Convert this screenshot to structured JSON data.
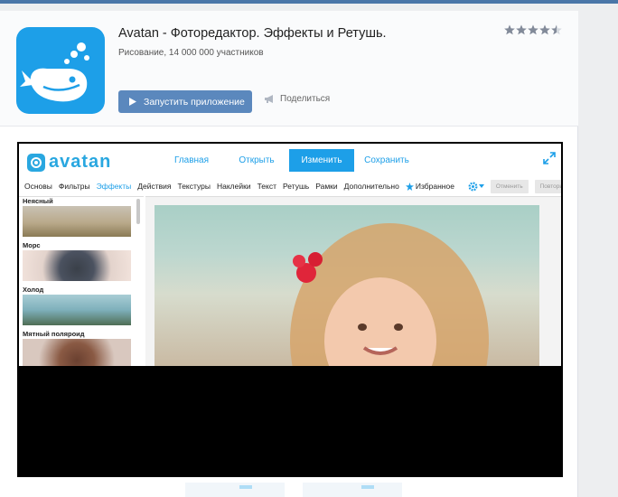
{
  "app": {
    "title": "Avatan - Фоторедактор. Эффекты и Ретушь.",
    "subtitle": "Рисование, 14 000 000 участников",
    "rating_stars": 4.5,
    "launch_label": "Запустить приложение",
    "share_label": "Поделиться"
  },
  "editor": {
    "logo_text": "avatan",
    "nav": [
      {
        "label": "Главная"
      },
      {
        "label": "Открыть"
      },
      {
        "label": "Изменить",
        "active": true
      },
      {
        "label": "Сохранить"
      }
    ],
    "tools": [
      "Основы",
      "Фильтры",
      "Эффекты",
      "Действия",
      "Текстуры",
      "Наклейки",
      "Текст",
      "Ретушь",
      "Рамки",
      "Дополнительно"
    ],
    "selected_tool": "Эффекты",
    "favorites_label": "Избранное",
    "undo_label": "Отменить",
    "redo_label": "Повторить",
    "effects": [
      {
        "label": "Неясный"
      },
      {
        "label": "Морс"
      },
      {
        "label": "Холод"
      },
      {
        "label": "Мятный поляроид"
      }
    ]
  },
  "colors": {
    "accent": "#1d9fe8",
    "button": "#5b88bd",
    "vk_blue": "#4a76a8"
  }
}
